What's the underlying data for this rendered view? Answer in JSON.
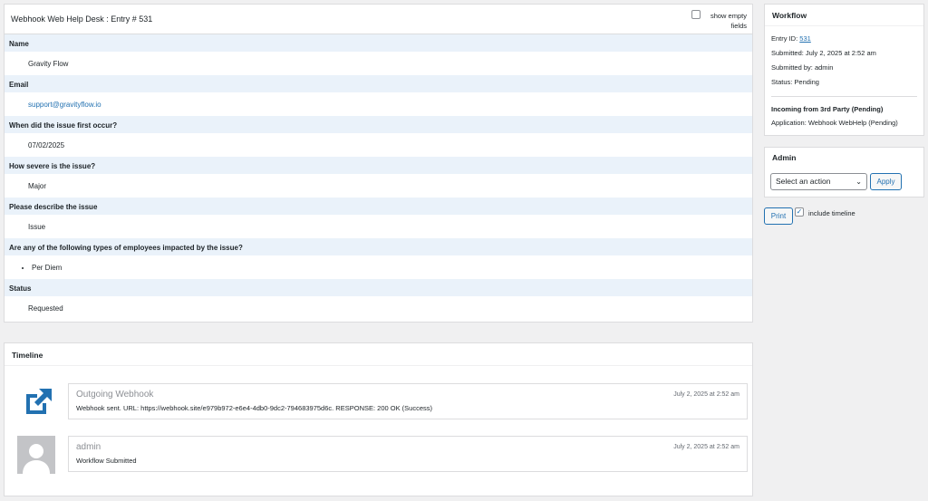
{
  "entry": {
    "title": "Webhook Web Help Desk : Entry # 531",
    "show_empty_label": "show empty fields",
    "fields": [
      {
        "label": "Name",
        "value": "Gravity Flow"
      },
      {
        "label": "Email",
        "value": "support@gravityflow.io"
      },
      {
        "label": "When did the issue first occur?",
        "value": "07/02/2025"
      },
      {
        "label": "How severe is the issue?",
        "value": "Major"
      },
      {
        "label": "Please describe the issue",
        "value": "Issue"
      },
      {
        "label": "Are any of the following types of employees impacted by the issue?",
        "value": "Per Diem"
      },
      {
        "label": "Status",
        "value": "Requested"
      }
    ]
  },
  "timeline": {
    "title": "Timeline",
    "items": [
      {
        "who": "Outgoing Webhook",
        "when": "July 2, 2025 at 2:52 am",
        "message": "Webhook sent. URL: https://webhook.site/e979b972-e6e4-4db0-9dc2-794683975d6c. RESPONSE: 200 OK (Success)",
        "icon": "external-link-icon"
      },
      {
        "who": "admin",
        "when": "July 2, 2025 at 2:52 am",
        "message": "Workflow Submitted",
        "icon": "avatar-placeholder-icon"
      }
    ]
  },
  "workflow": {
    "title": "Workflow",
    "entry_id_label": "Entry ID:",
    "entry_id": "531",
    "submitted": "Submitted: July 2, 2025 at 2:52 am",
    "submitted_by": "Submitted by: admin",
    "status": "Status: Pending",
    "step_title": "Incoming from 3rd Party (Pending)",
    "application": "Application: Webhook WebHelp (Pending)"
  },
  "admin": {
    "title": "Admin",
    "select_value": "Select an action",
    "apply_label": "Apply"
  },
  "print": {
    "button_label": "Print",
    "include_timeline_label": "include timeline",
    "include_timeline_checked": true
  },
  "colors": {
    "accent": "#2271b1",
    "label_bg": "#eaf2fa",
    "page_bg": "#f0f0f1"
  }
}
